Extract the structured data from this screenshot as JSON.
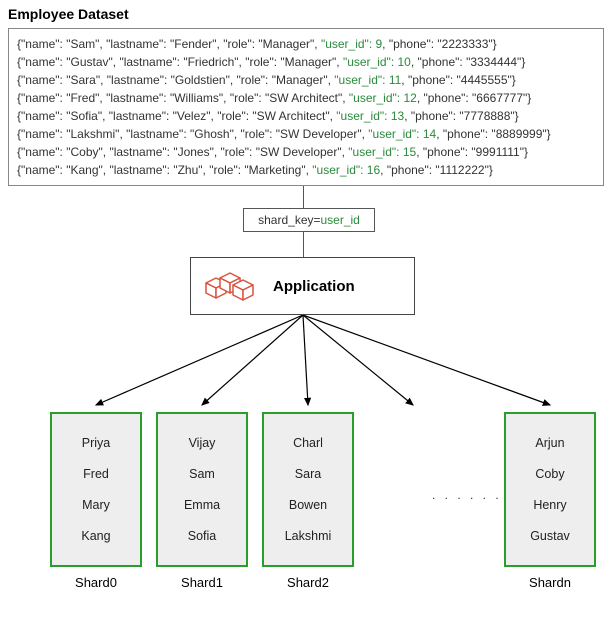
{
  "title": "Employee Dataset",
  "records": [
    {
      "name": "Sam",
      "lastname": "Fender",
      "role": "Manager",
      "user_id": 9,
      "phone": "2223333"
    },
    {
      "name": "Gustav",
      "lastname": "Friedrich",
      "role": "Manager",
      "user_id": 10,
      "phone": "3334444"
    },
    {
      "name": "Sara",
      "lastname": "Goldstien",
      "role": "Manager",
      "user_id": 11,
      "phone": "4445555"
    },
    {
      "name": "Fred",
      "lastname": "Williams",
      "role": "SW Architect",
      "user_id": 12,
      "phone": "6667777"
    },
    {
      "name": "Sofia",
      "lastname": "Velez",
      "role": "SW Architect",
      "user_id": 13,
      "phone": "7778888"
    },
    {
      "name": "Lakshmi",
      "lastname": "Ghosh",
      "role": "SW Developer",
      "user_id": 14,
      "phone": "8889999"
    },
    {
      "name": "Coby",
      "lastname": "Jones",
      "role": "SW Developer",
      "user_id": 15,
      "phone": "9991111"
    },
    {
      "name": "Kang",
      "lastname": "Zhu",
      "role": "Marketing",
      "user_id": 16,
      "phone": "1112222"
    }
  ],
  "shard_key_label": "shard_key=",
  "shard_key_value": "user_id",
  "app_label": "Application",
  "shards": [
    {
      "label": "Shard0",
      "items": [
        "Priya",
        "Fred",
        "Mary",
        "Kang"
      ]
    },
    {
      "label": "Shard1",
      "items": [
        "Vijay",
        "Sam",
        "Emma",
        "Sofia"
      ]
    },
    {
      "label": "Shard2",
      "items": [
        "Charl",
        "Sara",
        "Bowen",
        "Lakshmi"
      ]
    },
    {
      "label": "Shardn",
      "items": [
        "Arjun",
        "Coby",
        "Henry",
        "Gustav"
      ]
    }
  ],
  "ellipsis": ". . . . . . . ."
}
